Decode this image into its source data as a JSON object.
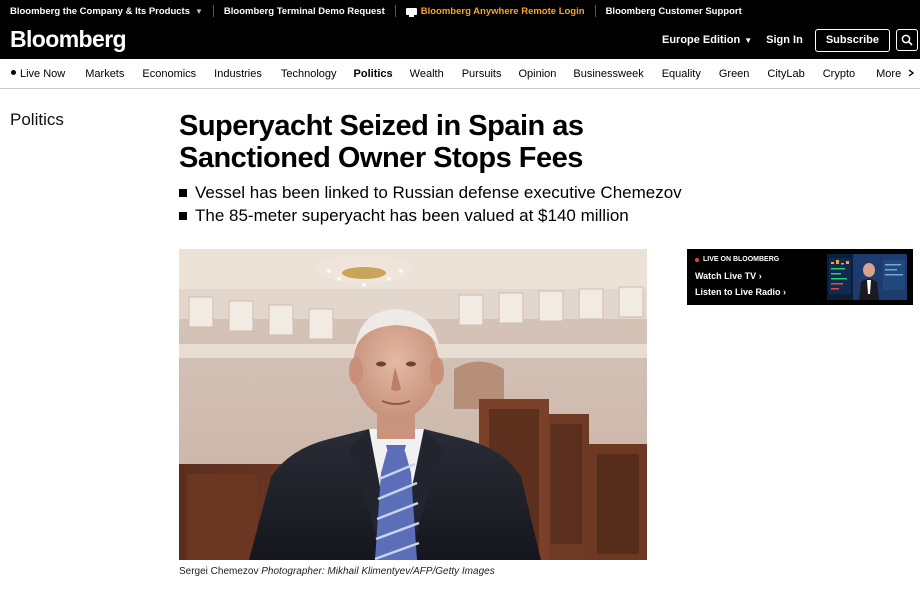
{
  "topbar": {
    "company": "Bloomberg the Company & Its Products",
    "terminal_demo": "Bloomberg Terminal Demo Request",
    "anywhere": "Bloomberg Anywhere Remote Login",
    "support": "Bloomberg Customer Support"
  },
  "brand": {
    "logo": "Bloomberg",
    "edition": "Europe Edition",
    "signin": "Sign In",
    "subscribe": "Subscribe"
  },
  "nav": {
    "items": [
      "Live Now",
      "Markets",
      "Economics",
      "Industries",
      "Technology",
      "Politics",
      "Wealth",
      "Pursuits",
      "Opinion",
      "Businessweek",
      "Equality",
      "Green",
      "CityLab",
      "Crypto",
      "More"
    ],
    "active": "Politics"
  },
  "article": {
    "section": "Politics",
    "headline": "Superyacht Seized in Spain as Sanctioned Owner Stops Fees",
    "bullets": [
      "Vessel has been linked to Russian defense executive Chemezov",
      "The 85-meter superyacht has been valued at $140 million"
    ],
    "caption_subject": "Sergei Chemezov",
    "caption_credit": "Photographer: Mikhail Klimentyev/AFP/Getty Images"
  },
  "live": {
    "header": "LIVE ON BLOOMBERG",
    "tv": "Watch Live TV",
    "radio": "Listen to Live Radio"
  },
  "colors": {
    "orange": "#f5a623",
    "live_red": "#e8413c",
    "black": "#000000"
  },
  "icons": {
    "search": "search-icon",
    "remote": "remote-desktop-icon",
    "caret": "chevron-down-icon",
    "live_dot": "live-dot-icon"
  }
}
